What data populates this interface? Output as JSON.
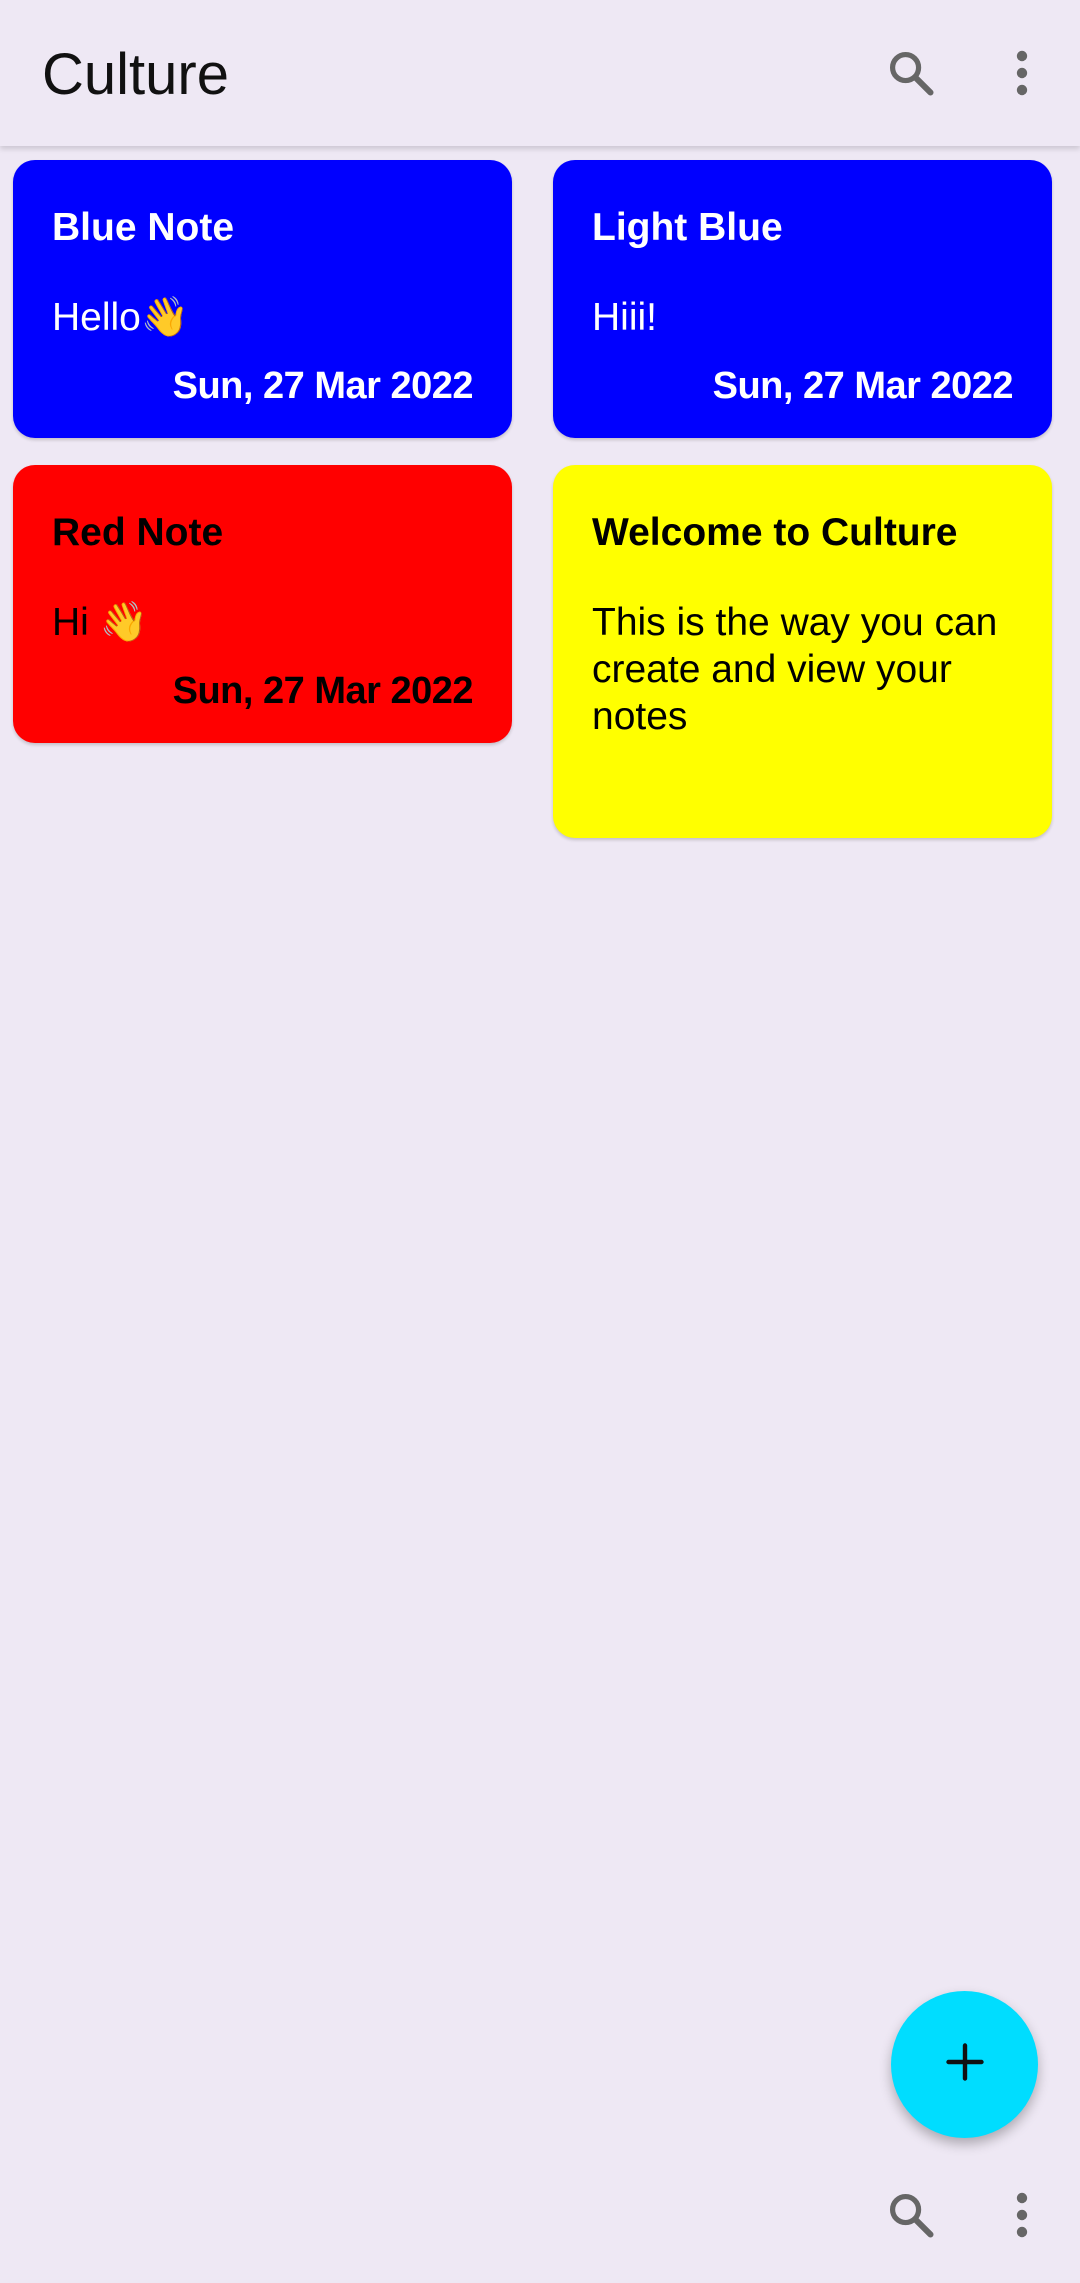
{
  "app_bar": {
    "title": "Culture",
    "search_icon": "search-icon",
    "menu_icon": "more-vert-icon"
  },
  "notes": [
    {
      "title": "Blue Note",
      "body": "Hello👋",
      "date": "Sun, 27 Mar 2022",
      "background": "#0000FF",
      "text_color": "#FFFFFF"
    },
    {
      "title": "Light Blue",
      "body": "Hiii!",
      "date": "Sun, 27 Mar 2022",
      "background": "#0000FF",
      "text_color": "#FFFFFF"
    },
    {
      "title": "Red Note",
      "body": "Hi 👋",
      "date": "Sun, 27 Mar 2022",
      "background": "#FF0000",
      "text_color": "#000000"
    },
    {
      "title": "Welcome to Culture",
      "body": "This is the way you can create and view your notes",
      "date": "",
      "background": "#FFFF00",
      "text_color": "#000000"
    }
  ],
  "fab": {
    "icon": "plus-icon",
    "color": "#00DDFF"
  },
  "bottom_bar": {
    "search_icon": "search-icon",
    "menu_icon": "more-vert-icon"
  },
  "colors": {
    "background": "#EEE8F4",
    "icon_gray": "#666666"
  }
}
